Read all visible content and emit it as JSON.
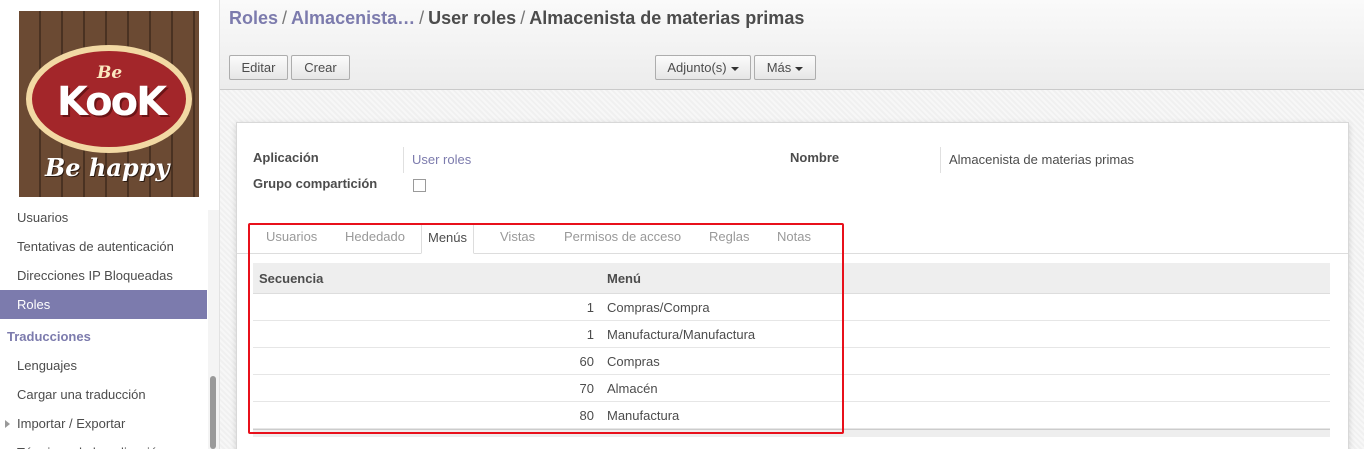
{
  "sidebar": {
    "logo": {
      "top_text": "Be",
      "main_text": "KooK",
      "tagline": "Be happy"
    },
    "items": [
      {
        "label": "Usuarios",
        "active": false
      },
      {
        "label": "Tentativas de autenticación",
        "active": false
      },
      {
        "label": "Direcciones IP Bloqueadas",
        "active": false
      },
      {
        "label": "Roles",
        "active": true
      }
    ],
    "section_header": "Traducciones",
    "section_items": [
      {
        "label": "Lenguajes"
      },
      {
        "label": "Cargar una traducción"
      },
      {
        "label": "Importar / Exportar"
      },
      {
        "label": "Términos de la aplicación"
      }
    ]
  },
  "breadcrumb": {
    "items": [
      "Roles",
      "Almacenista…",
      "User roles"
    ],
    "current": "Almacenista de materias primas",
    "separator": "/"
  },
  "toolbar": {
    "edit_label": "Editar",
    "create_label": "Crear",
    "attachments_label": "Adjunto(s)",
    "more_label": "Más"
  },
  "form": {
    "application_label": "Aplicación",
    "application_value": "User roles",
    "group_share_label": "Grupo compartición",
    "group_share_checked": false,
    "name_label": "Nombre",
    "name_value": "Almacenista de materias primas"
  },
  "tabs": [
    {
      "label": "Usuarios",
      "active": false
    },
    {
      "label": "Hededado",
      "active": false
    },
    {
      "label": "Menús",
      "active": true
    },
    {
      "label": "Vistas",
      "active": false
    },
    {
      "label": "Permisos de acceso",
      "active": false
    },
    {
      "label": "Reglas",
      "active": false
    },
    {
      "label": "Notas",
      "active": false
    }
  ],
  "table": {
    "columns": [
      "Secuencia",
      "Menú"
    ],
    "rows": [
      {
        "sequence": "1",
        "menu": "Compras/Compra"
      },
      {
        "sequence": "1",
        "menu": "Manufactura/Manufactura"
      },
      {
        "sequence": "60",
        "menu": "Compras"
      },
      {
        "sequence": "70",
        "menu": "Almacén"
      },
      {
        "sequence": "80",
        "menu": "Manufactura"
      }
    ]
  },
  "colors": {
    "accent": "#7c7bad",
    "highlight": "#e8101b"
  }
}
